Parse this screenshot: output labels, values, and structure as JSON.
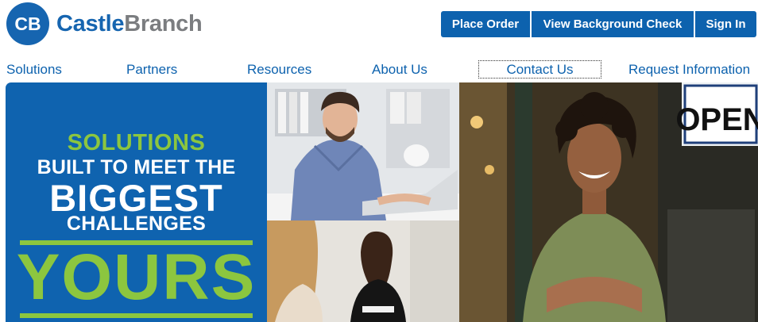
{
  "brand": {
    "mark": "CB",
    "name_part1": "Castle",
    "name_part2": "Branch"
  },
  "top_buttons": {
    "place_order": "Place Order",
    "view_background_check": "View Background Check",
    "sign_in": "Sign In"
  },
  "nav": {
    "solutions": "Solutions",
    "partners": "Partners",
    "resources": "Resources",
    "about_us": "About Us",
    "contact_us": "Contact Us",
    "request_information": "Request Information"
  },
  "hero": {
    "line1": "SOLUTIONS",
    "line2": "BUILT TO MEET THE",
    "line3": "BIGGEST",
    "line4": "CHALLENGES",
    "line5": "YOURS",
    "sign_text": "OPEN"
  },
  "colors": {
    "brand_blue": "#0d62ae",
    "brand_gray": "#7b7d80",
    "accent_green": "#8cc63f"
  }
}
